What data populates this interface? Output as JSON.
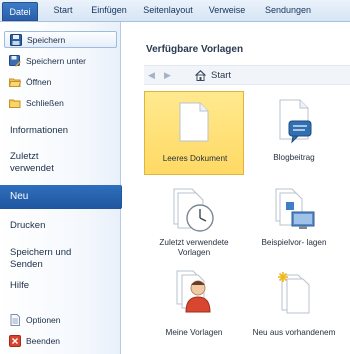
{
  "ribbon": {
    "tabs": [
      "Datei",
      "Start",
      "Einfügen",
      "Seitenlayout",
      "Verweise",
      "Sendungen"
    ]
  },
  "nav": {
    "speichern": "Speichern",
    "speichern_unter": "Speichern unter",
    "oeffnen": "Öffnen",
    "schliessen": "Schließen",
    "informationen": "Informationen",
    "zuletzt": "Zuletzt verwendet",
    "neu": "Neu",
    "drucken": "Drucken",
    "speichern_senden": "Speichern und Senden",
    "hilfe": "Hilfe",
    "optionen": "Optionen",
    "beenden": "Beenden"
  },
  "main": {
    "title": "Verfügbare Vorlagen",
    "breadcrumb": "Start",
    "templates": [
      {
        "label": "Leeres Dokument",
        "icon": "blank-document-icon",
        "selected": true
      },
      {
        "label": "Blogbeitrag",
        "icon": "blog-post-icon",
        "selected": false
      },
      {
        "label": "Zuletzt verwendete Vorlagen",
        "icon": "recent-templates-icon",
        "selected": false
      },
      {
        "label": "Beispielvor- lagen",
        "icon": "sample-templates-icon",
        "selected": false
      },
      {
        "label": "Meine Vorlagen",
        "icon": "my-templates-icon",
        "selected": false
      },
      {
        "label": "Neu aus vorhandenem",
        "icon": "new-from-existing-icon",
        "selected": false
      }
    ]
  },
  "colors": {
    "file_tab": "#2a5ea8",
    "selected_nav": "#1f559f",
    "selected_tile": "#ffd964"
  }
}
